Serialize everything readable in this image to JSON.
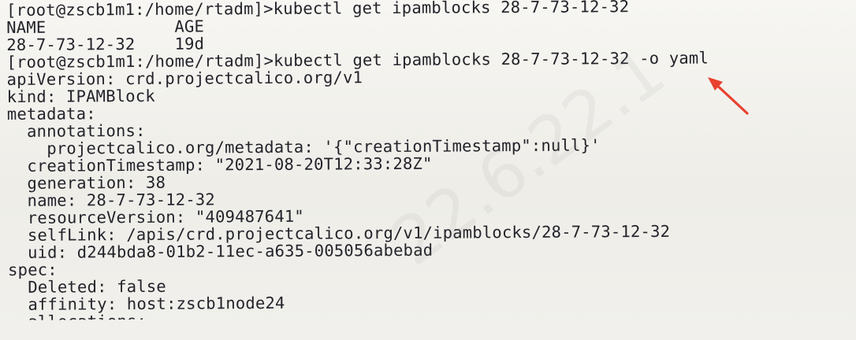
{
  "terminal": {
    "lines": [
      "[root@zscb1m1:/home/rtadm]>kubectl get ipamblocks 28-7-73-12-32",
      "NAME             AGE",
      "28-7-73-12-32    19d",
      "[root@zscb1m1:/home/rtadm]>kubectl get ipamblocks 28-7-73-12-32 -o yaml",
      "apiVersion: crd.projectcalico.org/v1",
      "kind: IPAMBlock",
      "metadata:",
      "  annotations:",
      "    projectcalico.org/metadata: '{\"creationTimestamp\":null}'",
      "  creationTimestamp: \"2021-08-20T12:33:28Z\"",
      "  generation: 38",
      "  name: 28-7-73-12-32",
      "  resourceVersion: \"409487641\"",
      "  selfLink: /apis/crd.projectcalico.org/v1/ipamblocks/28-7-73-12-32",
      "  uid: d244bda8-01b2-11ec-a635-005056abebad",
      "spec:",
      "  Deleted: false",
      "  affinity: host:zscb1node24",
      "  allocations:"
    ]
  },
  "arrow_color": "#e8412f",
  "watermark_text": "22.6.22.1"
}
